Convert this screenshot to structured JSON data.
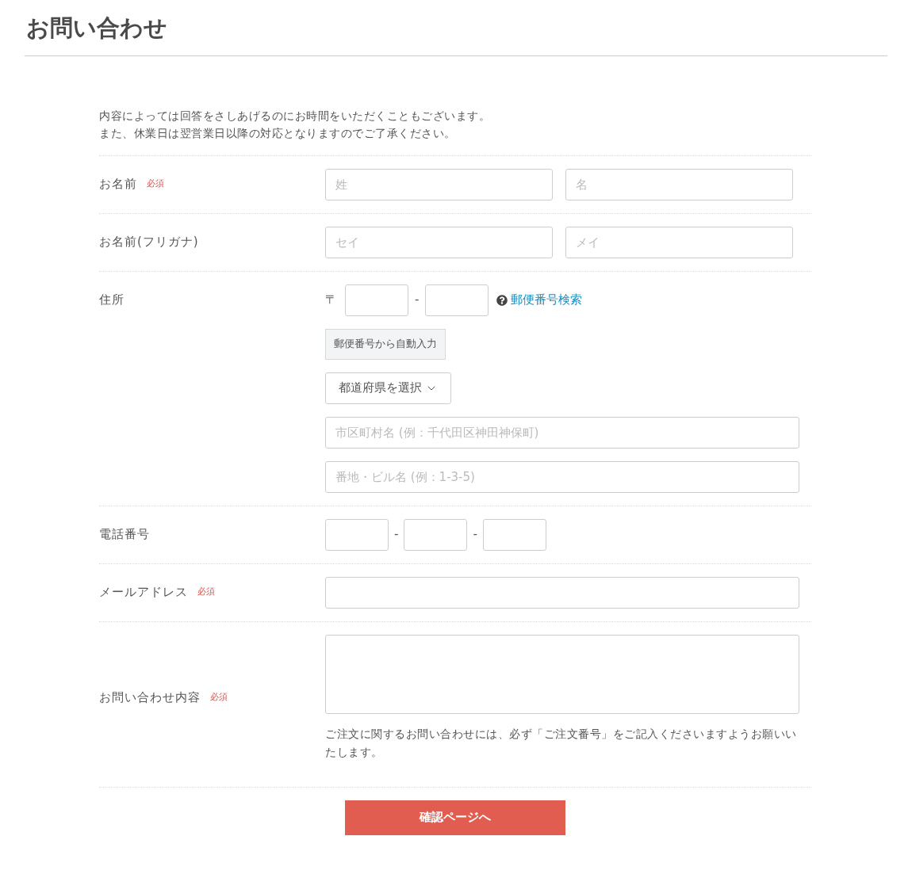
{
  "title": "お問い合わせ",
  "intro": [
    "内容によっては回答をさしあげるのにお時間をいただくこともございます。",
    "また、休業日は翌営業日以降の対応となりますのでご了承ください。"
  ],
  "rows": [
    {
      "kind": "pair",
      "label": "お名前",
      "badge": "必須",
      "fields": [
        {
          "placeholder": "姓"
        },
        {
          "placeholder": "名"
        }
      ]
    },
    {
      "kind": "pair",
      "label": "お名前(フリガナ)",
      "fields": [
        {
          "placeholder": "セイ"
        },
        {
          "placeholder": "メイ"
        }
      ]
    },
    {
      "kind": "address",
      "label": "住所",
      "postal_mark": "〒",
      "separator": "-",
      "search_link": "郵便番号検索",
      "autofill_button": "郵便番号から自動入力",
      "prefecture_select": "都道府県を選択",
      "fields": [
        {
          "placeholder": "市区町村名 (例：千代田区神田神保町)"
        },
        {
          "placeholder": "番地・ビル名 (例：1-3-5)"
        }
      ]
    },
    {
      "kind": "phone",
      "label": "電話番号",
      "separators": [
        "-",
        "-"
      ]
    },
    {
      "kind": "email",
      "label": "メールアドレス",
      "badge": "必須"
    },
    {
      "kind": "message",
      "label": "お問い合わせ内容",
      "badge": "必須",
      "note": "ご注文に関するお問い合わせには、必ず「ご注文番号」をご記入くださいますようお願いいたします。"
    }
  ],
  "submit": "確認ページへ"
}
